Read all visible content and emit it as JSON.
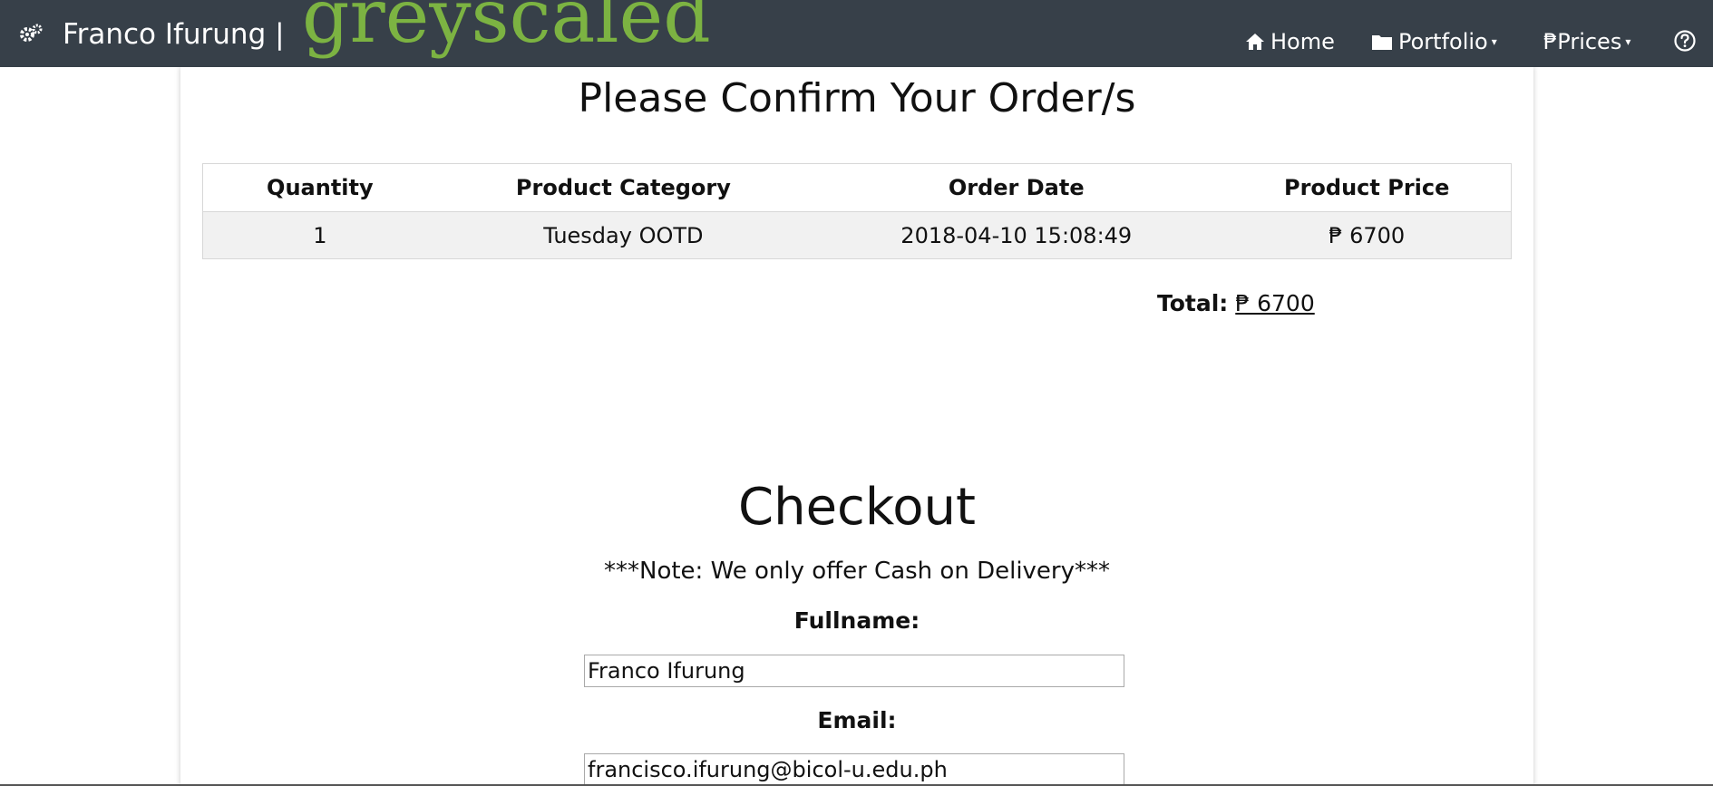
{
  "nav": {
    "brand_name": "Franco Ifurung |",
    "brand_logo": "greyscaled",
    "home_label": "Home",
    "portfolio_label": "Portfolio",
    "prices_label": "₱Prices",
    "caret": "▾",
    "icons": [
      "gears-icon",
      "home-icon",
      "folder-icon",
      "help-icon"
    ]
  },
  "order": {
    "title": "Please Confirm Your Order/s",
    "columns": [
      "Quantity",
      "Product Category",
      "Order Date",
      "Product Price"
    ],
    "rows": [
      [
        "1",
        "Tuesday OOTD",
        "2018-04-10 15:08:49",
        "₱ 6700"
      ]
    ],
    "total_label": "Total:",
    "total_value": "₱ 6700"
  },
  "checkout": {
    "title": "Checkout",
    "note": "***Note: We only offer Cash on Delivery***",
    "fullname_label": "Fullname:",
    "fullname_value": "Franco Ifurung",
    "email_label": "Email:",
    "email_value": "francisco.ifurung@bicol-u.edu.ph"
  },
  "colors": {
    "navbar": "#374049",
    "logo": "#7cb342"
  }
}
